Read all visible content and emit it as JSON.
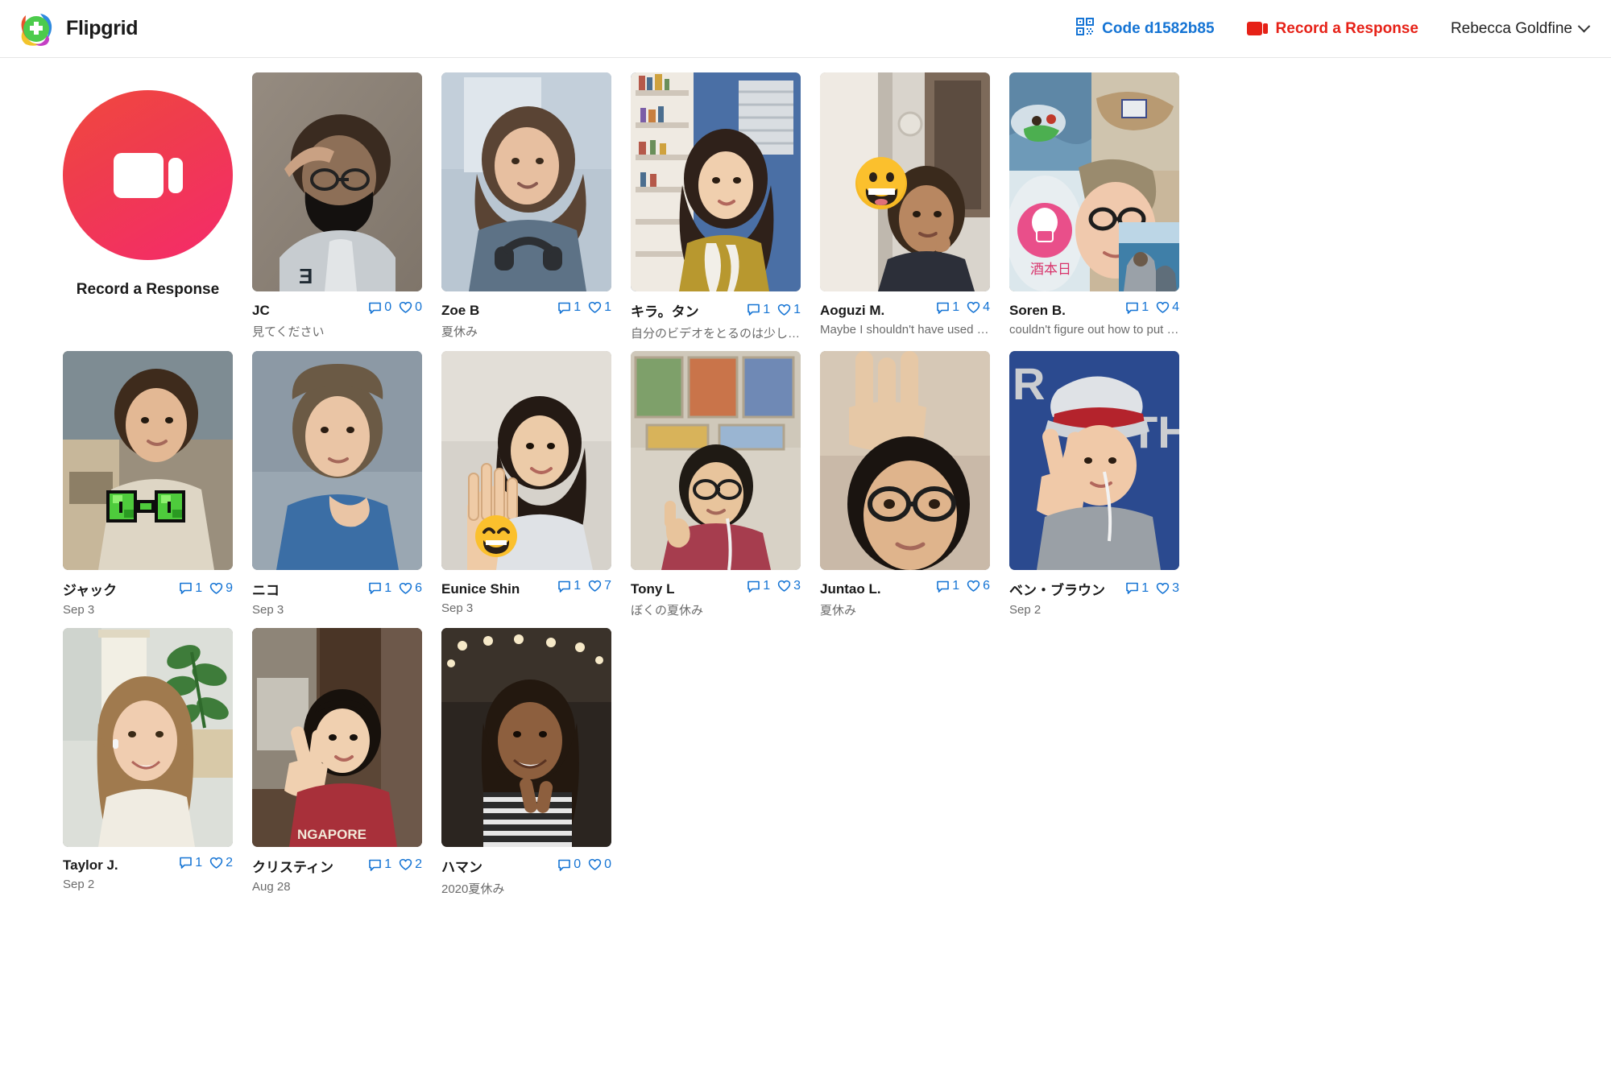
{
  "header": {
    "brand_name": "Flipgrid",
    "brand_logo_icon": "flipgrid-plus-logo",
    "qr_icon": "qr-code-icon",
    "code_label": "Code d1582b85",
    "record_icon": "video-camera-icon",
    "record_label": "Record a Response",
    "user_name": "Rebecca Goldfine",
    "user_chevron_icon": "chevron-down-icon",
    "code_color": "#1574d4",
    "record_color": "#e62117"
  },
  "record_tile": {
    "icon": "video-camera-icon",
    "label": "Record a Response",
    "gradient_from": "#f0483e",
    "gradient_to": "#f52a6b"
  },
  "cards": [
    {
      "name": "JC",
      "subtitle": "見てください",
      "comments": "0",
      "likes": "0",
      "thumb": "jc-salute-mask",
      "sticker": "none"
    },
    {
      "name": "Zoe B",
      "subtitle": "夏休み",
      "comments": "1",
      "likes": "1",
      "thumb": "zoe-headphones",
      "sticker": "none"
    },
    {
      "name": "キラ。タン",
      "subtitle": "自分のビデオをとるのは少しはずか…",
      "comments": "1",
      "likes": "1",
      "thumb": "kira-bookshelf",
      "sticker": "none"
    },
    {
      "name": "Aoguzi M.",
      "subtitle": "Maybe I shouldn't have used my phon…",
      "comments": "1",
      "likes": "4",
      "thumb": "aoguzi-hallway",
      "sticker": "grinning-face-emoji"
    },
    {
      "name": "Soren B.",
      "subtitle": "couldn't figure out how to put fancy pi…",
      "comments": "1",
      "likes": "4",
      "thumb": "soren-collage",
      "sticker": "none"
    },
    {
      "name": "ジャック",
      "subtitle": "Sep 3",
      "comments": "1",
      "likes": "9",
      "thumb": "jack-outdoor",
      "sticker": "green-pixel-bowtie"
    },
    {
      "name": "ニコ",
      "subtitle": "Sep 3",
      "comments": "1",
      "likes": "6",
      "thumb": "niko-blue-shirt",
      "sticker": "none"
    },
    {
      "name": "Eunice Shin",
      "subtitle": "Sep 3",
      "comments": "1",
      "likes": "7",
      "thumb": "eunice-wave",
      "sticker": "smiling-eyes-emoji"
    },
    {
      "name": "Tony L",
      "subtitle": "ぼくの夏休み",
      "comments": "1",
      "likes": "3",
      "thumb": "tony-thumbsup",
      "sticker": "none"
    },
    {
      "name": "Juntao L.",
      "subtitle": "夏休み",
      "comments": "1",
      "likes": "6",
      "thumb": "juntao-peace",
      "sticker": "none"
    },
    {
      "name": "ベン・ブラウン",
      "subtitle": "Sep 2",
      "comments": "1",
      "likes": "3",
      "thumb": "ben-cap-peace",
      "sticker": "none"
    },
    {
      "name": "Taylor J.",
      "subtitle": "Sep 2",
      "comments": "1",
      "likes": "2",
      "thumb": "taylor-plant",
      "sticker": "none"
    },
    {
      "name": "クリスティン",
      "subtitle": "Aug 28",
      "comments": "1",
      "likes": "2",
      "thumb": "kristin-peace",
      "sticker": "none"
    },
    {
      "name": "ハマン",
      "subtitle": "2020夏休み",
      "comments": "0",
      "likes": "0",
      "thumb": "haman-stripes",
      "sticker": "none"
    }
  ]
}
